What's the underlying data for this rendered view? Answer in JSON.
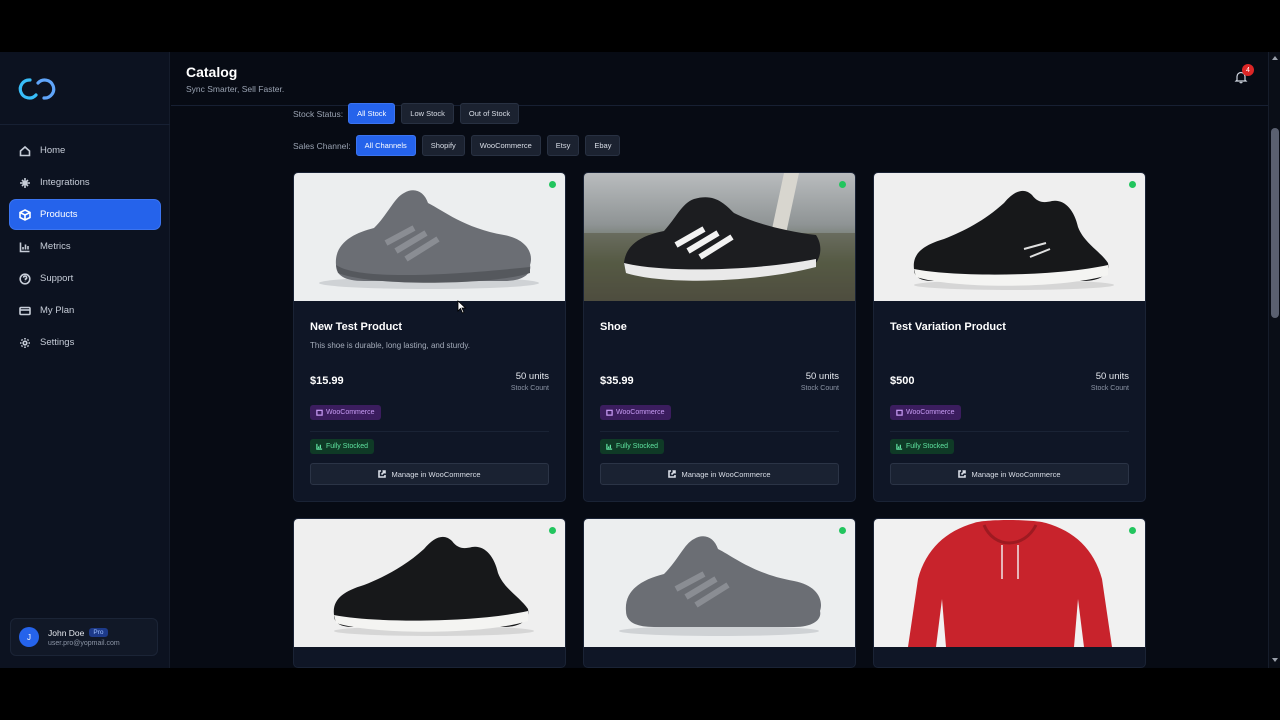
{
  "app": {
    "title": "Catalog",
    "subtitle": "Sync Smarter, Sell Faster.",
    "notification_count": "4"
  },
  "sidebar": {
    "items": [
      {
        "label": "Home",
        "icon": "home-icon"
      },
      {
        "label": "Integrations",
        "icon": "integrations-icon"
      },
      {
        "label": "Products",
        "icon": "box-icon",
        "active": true
      },
      {
        "label": "Metrics",
        "icon": "chart-icon"
      },
      {
        "label": "Support",
        "icon": "help-icon"
      },
      {
        "label": "My Plan",
        "icon": "card-icon"
      },
      {
        "label": "Settings",
        "icon": "gear-icon"
      }
    ],
    "user": {
      "initial": "J",
      "name": "John Doe",
      "plan": "Pro",
      "email": "user.pro@yopmail.com"
    }
  },
  "filters": {
    "stock_label": "Stock Status:",
    "stock_options": [
      "All Stock",
      "Low Stock",
      "Out of Stock"
    ],
    "stock_selected": "All Stock",
    "channel_label": "Sales Channel:",
    "channel_options": [
      "All Channels",
      "Shopify",
      "WooCommerce",
      "Etsy",
      "Ebay"
    ],
    "channel_selected": "All Channels"
  },
  "products": [
    {
      "title": "New Test Product",
      "description": "This shoe is durable, long lasting, and sturdy.",
      "price": "$15.99",
      "units": "50 units",
      "units_label": "Stock Count",
      "channel": "WooCommerce",
      "status": "Fully Stocked",
      "action": "Manage in WooCommerce"
    },
    {
      "title": "Shoe",
      "description": "",
      "price": "$35.99",
      "units": "50 units",
      "units_label": "Stock Count",
      "channel": "WooCommerce",
      "status": "Fully Stocked",
      "action": "Manage in WooCommerce"
    },
    {
      "title": "Test Variation Product",
      "description": "",
      "price": "$500",
      "units": "50 units",
      "units_label": "Stock Count",
      "channel": "WooCommerce",
      "status": "Fully Stocked",
      "action": "Manage in WooCommerce"
    }
  ],
  "colors": {
    "accent": "#2563eb",
    "stock_ok": "#22c55e",
    "channel_badge": "#3b1d5e",
    "status_badge": "#0f3a26"
  }
}
